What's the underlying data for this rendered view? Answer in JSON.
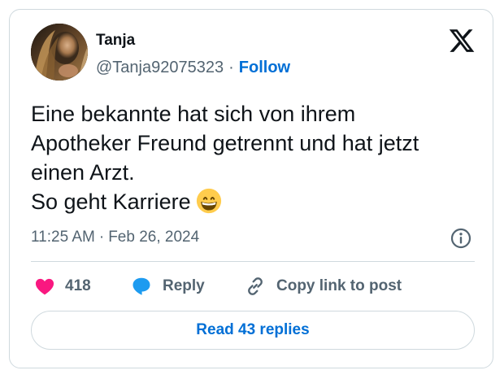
{
  "author": {
    "name": "Tanja",
    "handle": "@Tanja92075323",
    "separator": "·",
    "follow_label": "Follow",
    "avatar_icon": "profile-photo"
  },
  "brand_icon": "x-logo-icon",
  "tweet": {
    "lines": [
      "Eine bekannte hat sich von ihrem",
      "Apotheker Freund getrennt und hat jetzt",
      "einen Arzt.",
      "So geht Karriere"
    ],
    "emoji_icon": "grinning-face-emoji"
  },
  "meta": {
    "time": "11:25 AM",
    "separator": "·",
    "date": "Feb 26, 2024",
    "info_icon": "info-icon"
  },
  "actions": {
    "like_count": "418",
    "reply_label": "Reply",
    "copy_label": "Copy link to post"
  },
  "read_replies_label": "Read 43 replies",
  "colors": {
    "accent": "#006fd6",
    "heart": "#f91880",
    "reply_bubble": "#1d9bf0",
    "secondary_text": "#536471",
    "border": "#cfd9de"
  }
}
